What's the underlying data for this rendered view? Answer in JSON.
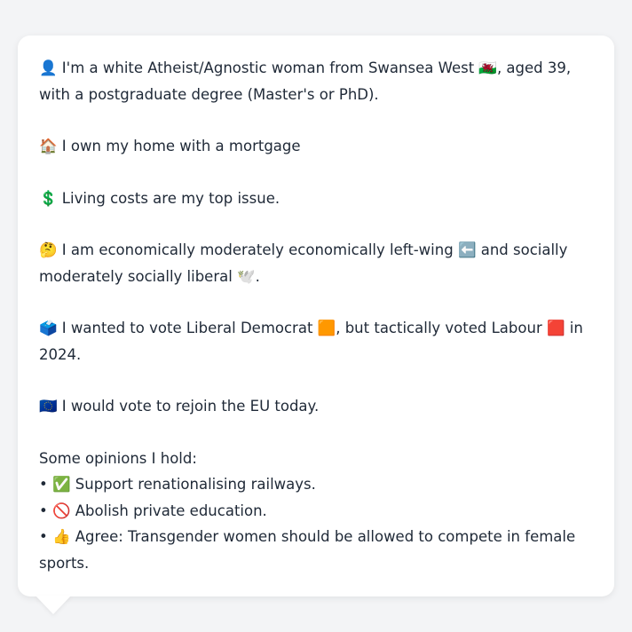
{
  "paragraphs": [
    "👤 I'm a white Atheist/Agnostic woman from Swansea West 🏴󠁧󠁢󠁷󠁬󠁳󠁿, aged 39, with a postgraduate degree (Master's or PhD).",
    "🏠 I own my home with a mortgage",
    "💲 Living costs are my top issue.",
    "🤔 I am economically moderately economically left-wing ⬅️ and socially moderately socially liberal 🕊️.",
    "🗳️ I wanted to vote Liberal Democrat 🟧, but tactically voted Labour 🟥 in 2024.",
    "🇪🇺 I would vote to rejoin the EU today."
  ],
  "opinions": {
    "heading": "Some opinions I hold:",
    "items": [
      "• ✅ Support renationalising railways.",
      "• 🚫 Abolish private education.",
      "• 👍 Agree: Transgender women should be allowed to compete in female sports."
    ]
  }
}
